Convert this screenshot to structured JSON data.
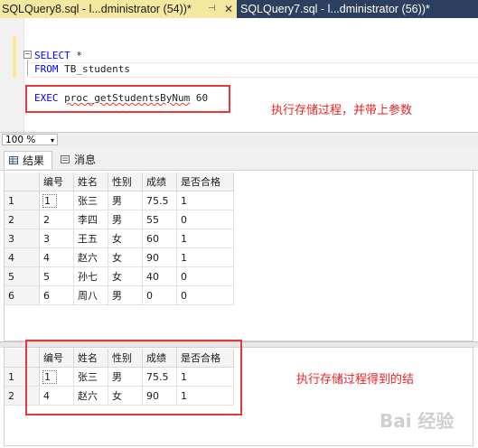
{
  "tabs": [
    {
      "title": "SQLQuery8.sql - l...dministrator (54))*",
      "pin": "⊣",
      "close": "✕"
    },
    {
      "title": "SQLQuery7.sql - l...dministrator (56))*"
    }
  ],
  "editor": {
    "line1_kw": "SELECT",
    "line1_rest": " *",
    "line2_kw": "FROM",
    "line2_rest": " TB_students",
    "line3_kw": "EXEC",
    "line3_proc": "proc_getStudentsByNum",
    "line3_rest": " 60",
    "collapse_symbol": "−"
  },
  "annotations": {
    "note1": "执行存储过程，并带上参数",
    "note2": "执行存储过程得到的结"
  },
  "zoom": {
    "value": "100 %",
    "arrow": "▾"
  },
  "results_tabs": {
    "results": "结果",
    "messages": "消息"
  },
  "grid1": {
    "headers": [
      "编号",
      "姓名",
      "性别",
      "成绩",
      "是否合格"
    ],
    "rows": [
      {
        "rownum": "1",
        "cells": [
          "1",
          "张三",
          "男",
          "75.5",
          "1"
        ]
      },
      {
        "rownum": "2",
        "cells": [
          "2",
          "李四",
          "男",
          "55",
          "0"
        ]
      },
      {
        "rownum": "3",
        "cells": [
          "3",
          "王五",
          "女",
          "60",
          "1"
        ]
      },
      {
        "rownum": "4",
        "cells": [
          "4",
          "赵六",
          "女",
          "90",
          "1"
        ]
      },
      {
        "rownum": "5",
        "cells": [
          "5",
          "孙七",
          "女",
          "40",
          "0"
        ]
      },
      {
        "rownum": "6",
        "cells": [
          "6",
          "周八",
          "男",
          "0",
          "0"
        ]
      }
    ]
  },
  "grid2": {
    "headers": [
      "编号",
      "姓名",
      "性别",
      "成绩",
      "是否合格"
    ],
    "rows": [
      {
        "rownum": "1",
        "cells": [
          "1",
          "张三",
          "男",
          "75.5",
          "1"
        ]
      },
      {
        "rownum": "2",
        "cells": [
          "4",
          "赵六",
          "女",
          "90",
          "1"
        ]
      }
    ]
  },
  "watermark": "Bai 经验"
}
